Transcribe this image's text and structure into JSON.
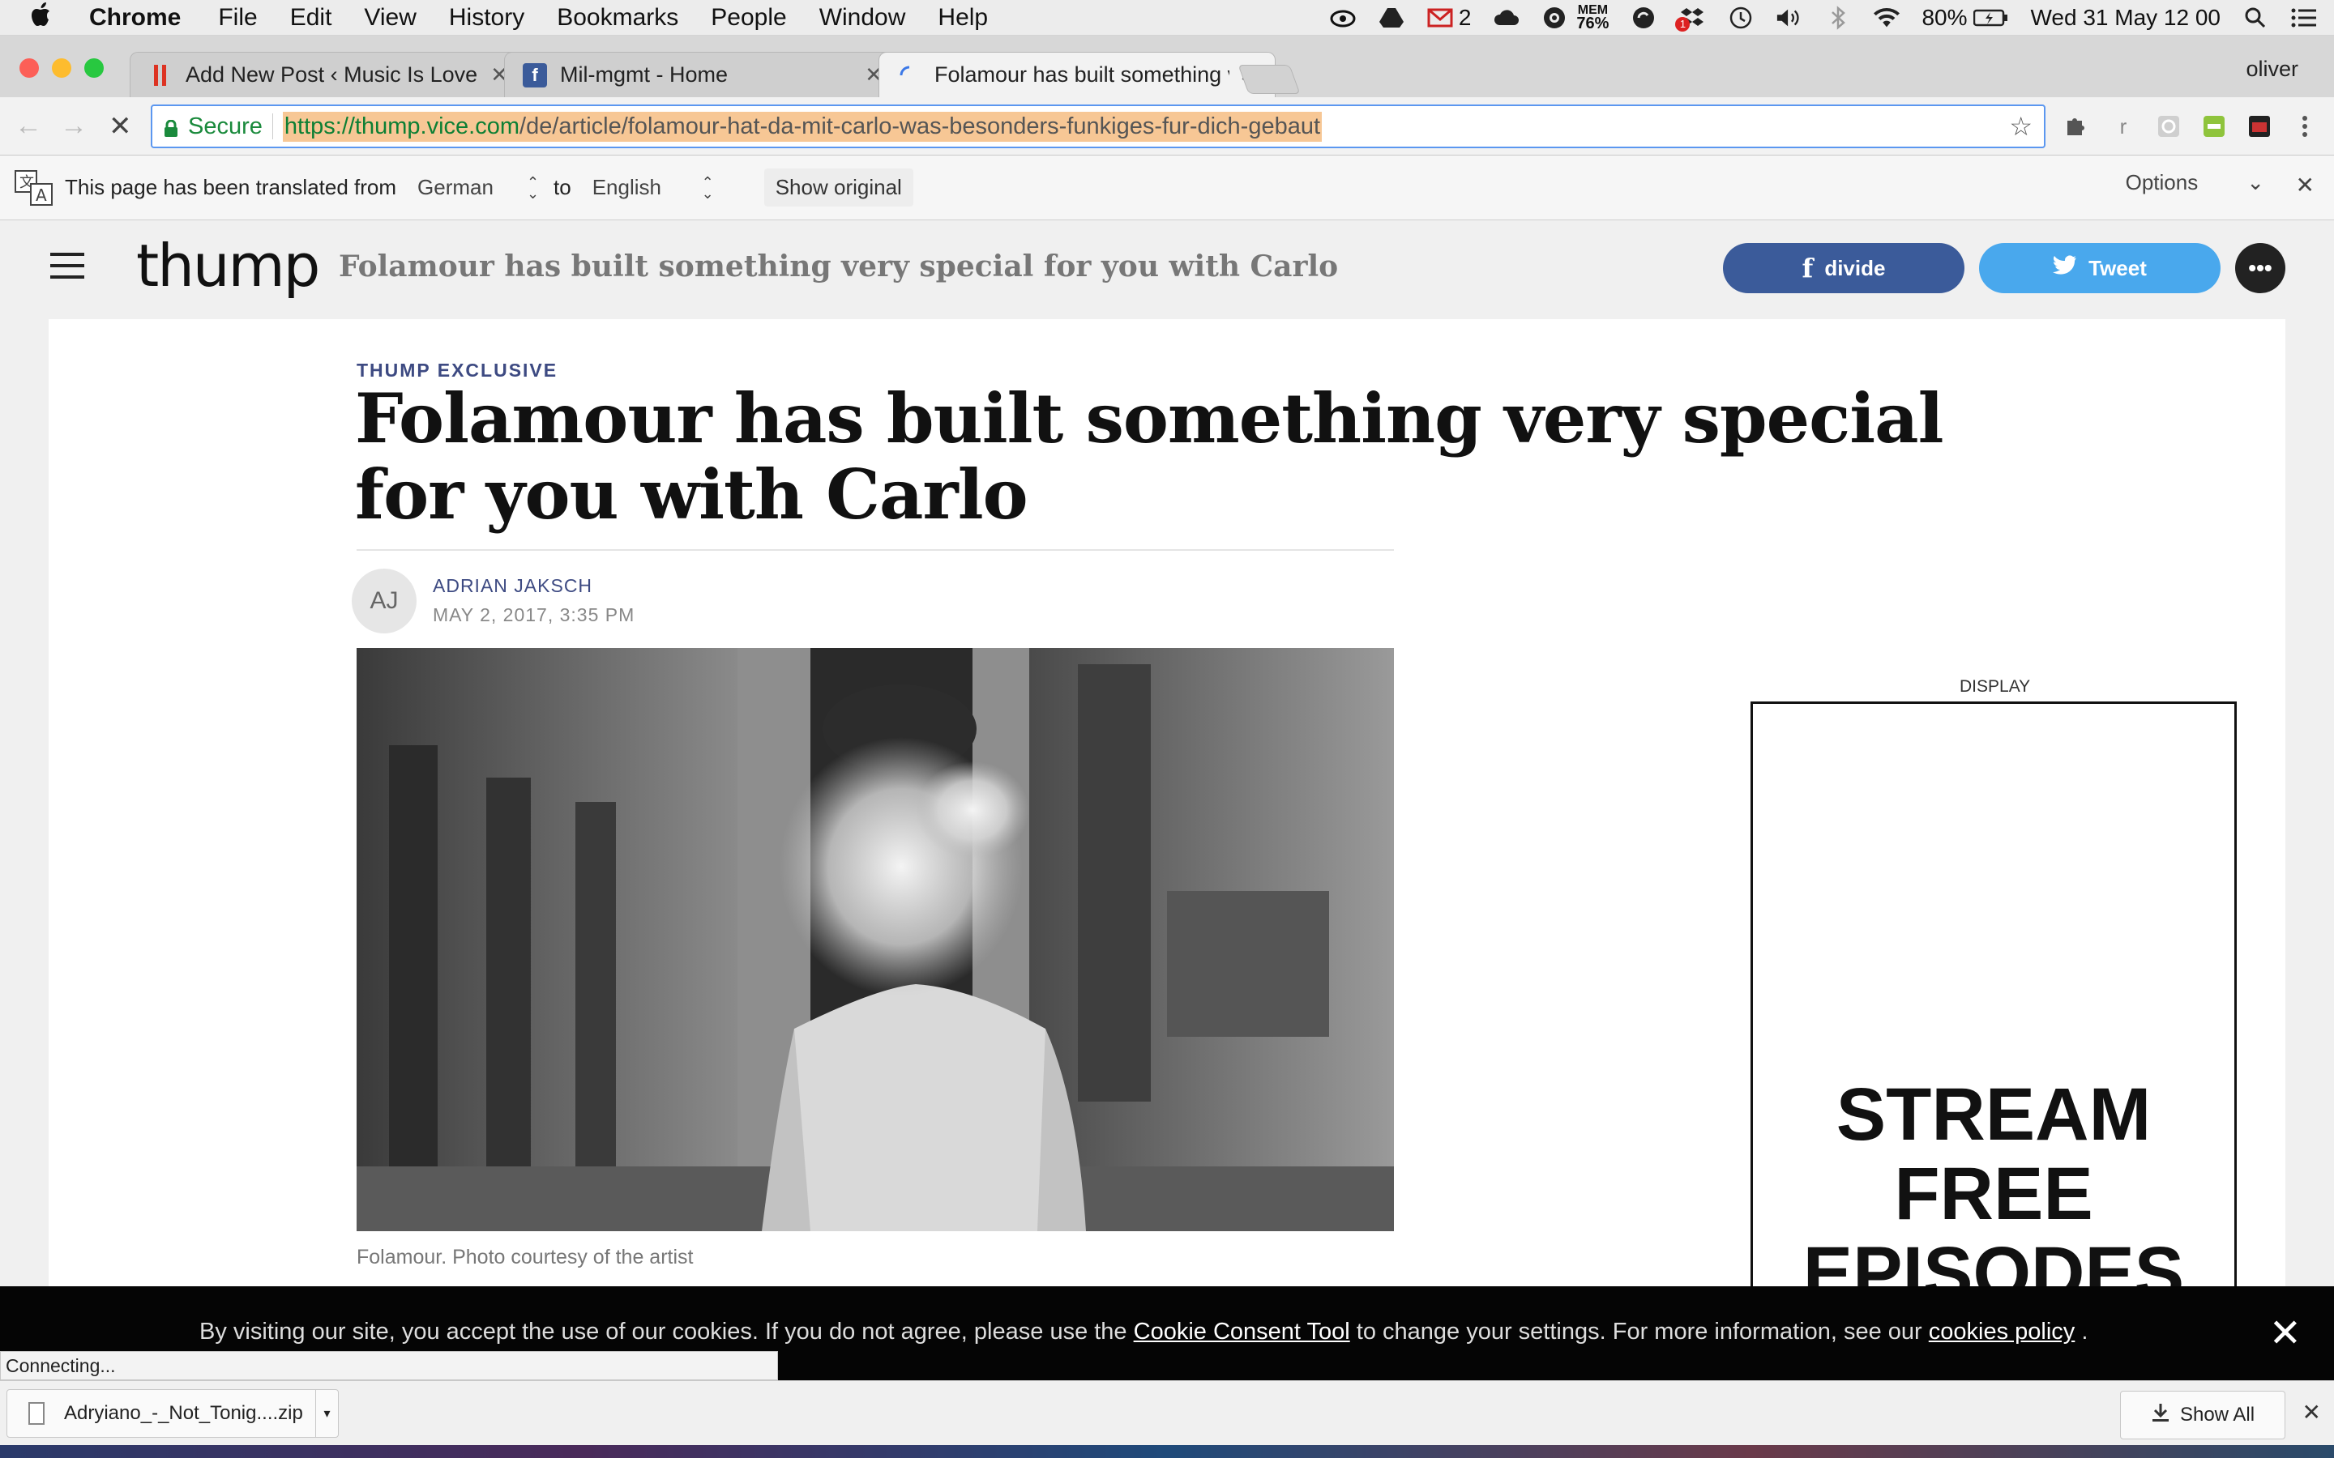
{
  "menubar": {
    "app": "Chrome",
    "items": [
      "File",
      "Edit",
      "View",
      "History",
      "Bookmarks",
      "People",
      "Window",
      "Help"
    ],
    "status": {
      "mail_count": "2",
      "mem_label": "MEM",
      "mem_value": "76%",
      "badge_count": "1",
      "battery": "80%",
      "datetime": "Wed 31 May  12 00"
    }
  },
  "tabs": [
    {
      "title": "Add New Post ‹ Music Is Love — WordPress",
      "favicon": "wordpress-icon"
    },
    {
      "title": "Mil-mgmt - Home",
      "favicon": "facebook-icon"
    },
    {
      "title": "Folamour has built something very special",
      "favicon": "loading-spinner-icon"
    }
  ],
  "profile": "oliver",
  "toolbar": {
    "secure_label": "Secure",
    "url_host": "https://thump.vice.com",
    "url_path": "/de/article/folamour-hat-da-mit-carlo-was-besonders-funkiges-fur-dich-gebaut",
    "ext_letter": "r"
  },
  "translate": {
    "prefix": "This page has been translated from",
    "from": "German",
    "to_word": "to",
    "to": "English",
    "show_original": "Show original",
    "options": "Options"
  },
  "site": {
    "logo": "thump",
    "header_title": "Folamour has built something very special for you with Carlo",
    "share_facebook": "divide",
    "share_twitter": "Tweet",
    "more": "•••"
  },
  "article": {
    "kicker": "THUMP EXCLUSIVE",
    "headline": "Folamour has built something very special for you with Carlo",
    "avatar_initials": "AJ",
    "author": "ADRIAN JAKSCH",
    "date": "MAY 2, 2017, 3:35 PM",
    "caption": "Folamour. Photo courtesy of the artist"
  },
  "ad": {
    "label": "DISPLAY",
    "text_lines": [
      "STREAM",
      "FREE",
      "EPISODES"
    ]
  },
  "cookie": {
    "text1": "By visiting our site, you accept the use of our cookies. If you do not agree, please use the ",
    "link1": "Cookie Consent Tool",
    "text2": " to change your settings. For more information, see our ",
    "link2": "cookies policy",
    "text3": " ."
  },
  "status_text": "Connecting...",
  "downloads": {
    "file_name": "Adryiano_-_Not_Tonig....zip",
    "show_all": "Show All"
  },
  "colors": {
    "facebook": "#3b5b9a",
    "twitter": "#49a8ed",
    "kicker": "#3d4a82",
    "secure_green": "#1a8a3c"
  }
}
